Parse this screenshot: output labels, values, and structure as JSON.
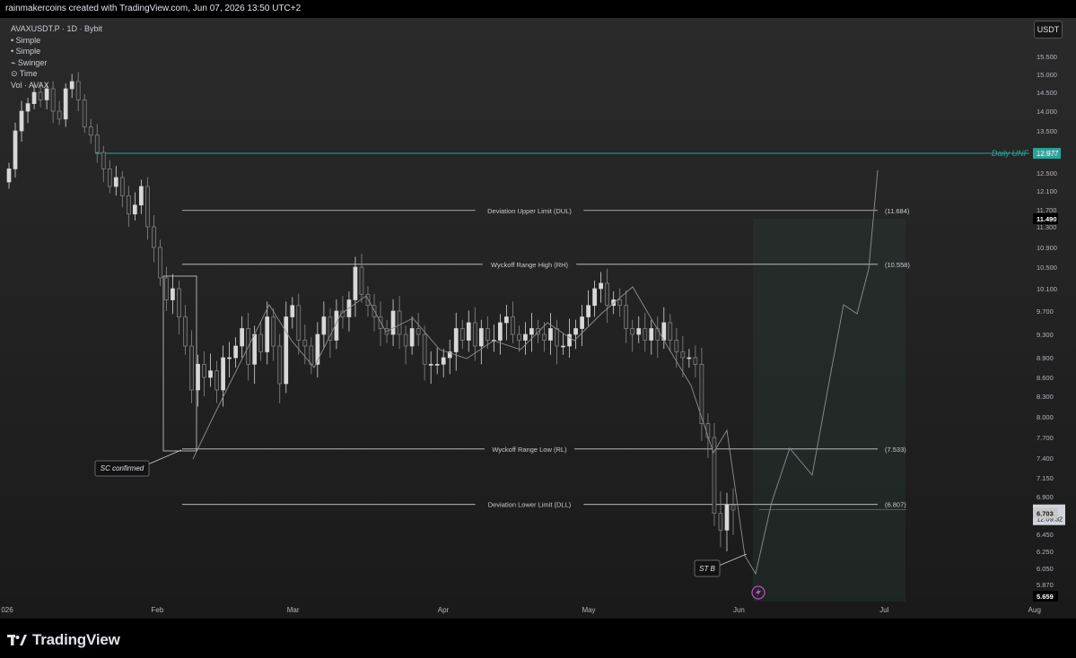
{
  "header": {
    "attribution": "rainmakercoins created with TradingView.com, Jun 07, 2026 13:50 UTC+2"
  },
  "legend": {
    "symbol": "AVAXUSDT.P · 1D · Bybit",
    "items": [
      "• Simple",
      "• Simple",
      "⌁ Swinger",
      "⊙ Time",
      "Vol · AVAX"
    ]
  },
  "currency_button": "USDT",
  "footer": {
    "brand": "TradingView"
  },
  "colors": {
    "accent": "#26a69a",
    "candle_up": "#d8d8d8",
    "candle_down": "#8a8a8a",
    "background": "#1e1e1e"
  },
  "chart_data": {
    "type": "candlestick",
    "instrument": "AVAXUSDT.P",
    "timeframe": "1D",
    "exchange": "Bybit",
    "x_axis": {
      "ticks": [
        {
          "label": "026",
          "day": 3
        },
        {
          "label": "Feb",
          "day": 34
        },
        {
          "label": "Mar",
          "day": 62
        },
        {
          "label": "Apr",
          "day": 93
        },
        {
          "label": "May",
          "day": 123
        },
        {
          "label": "Jun",
          "day": 154
        },
        {
          "label": "Jul",
          "day": 184
        },
        {
          "label": "Aug",
          "day": 215
        }
      ]
    },
    "y_axis": {
      "min": 5.659,
      "max": 15.9,
      "ticks": [
        "15.500",
        "15.000",
        "14.500",
        "14.000",
        "13.500",
        "13.000",
        "12.500",
        "12.100",
        "11.700",
        "11.300",
        "10.900",
        "10.500",
        "10.100",
        "9.700",
        "9.300",
        "8.900",
        "8.600",
        "8.300",
        "8.000",
        "7.700",
        "7.400",
        "7.150",
        "6.900",
        "6.450",
        "6.250",
        "6.050",
        "5.870"
      ]
    },
    "close_series": [
      12.6,
      13.5,
      14.0,
      14.2,
      14.5,
      14.3,
      14.6,
      14.0,
      13.8,
      14.6,
      14.8,
      14.3,
      13.6,
      13.4,
      13.0,
      12.6,
      12.2,
      12.4,
      12.0,
      11.6,
      11.8,
      12.2,
      11.3,
      10.9,
      10.3,
      9.9,
      10.1,
      9.6,
      9.1,
      8.4,
      8.8,
      8.6,
      8.7,
      8.4,
      8.9,
      8.9,
      9.1,
      9.4,
      8.8,
      9.3,
      9.0,
      9.6,
      9.1,
      8.5,
      9.6,
      9.8,
      9.2,
      9.1,
      8.8,
      9.3,
      9.6,
      9.2,
      9.7,
      9.6,
      9.9,
      10.5,
      10.0,
      9.8,
      9.6,
      9.4,
      9.3,
      9.7,
      9.3,
      9.1,
      9.4,
      9.3,
      8.8,
      8.8,
      8.8,
      8.9,
      9.0,
      9.4,
      9.2,
      9.5,
      9.1,
      9.4,
      9.2,
      9.2,
      9.5,
      9.6,
      9.3,
      9.2,
      9.3,
      9.4,
      9.3,
      9.2,
      9.4,
      9.1,
      9.1,
      9.3,
      9.4,
      9.6,
      9.8,
      10.1,
      10.2,
      9.8,
      9.9,
      9.8,
      9.4,
      9.3,
      9.4,
      9.2,
      9.4,
      9.2,
      9.5,
      9.2,
      9.0,
      8.9,
      8.9,
      8.8,
      7.9,
      7.7,
      6.7,
      6.5,
      6.8,
      6.74
    ],
    "levels": [
      {
        "label": "Daily UNF",
        "value": 12.977,
        "value_label": "12.977",
        "color": "#26a69a"
      },
      {
        "label": "Deviation Upper Limit (DUL)",
        "value": 11.684,
        "value_label": "(11.684)"
      },
      {
        "label": "Wyckoff Range High (RH)",
        "value": 10.558,
        "value_label": "(10.558)"
      },
      {
        "label": "Wyckoff Range Low (RL)",
        "value": 7.533,
        "value_label": "(7.533)"
      },
      {
        "label": "Deviation Lower Limit (DLL)",
        "value": 6.807,
        "value_label": "(6.807)"
      }
    ],
    "price_markers": [
      {
        "value": 11.49,
        "label": "11.490"
      },
      {
        "value": 6.742,
        "label": "6.742",
        "sublabel": "12:09:32"
      },
      {
        "value": 6.703,
        "label": "6.703"
      },
      {
        "value": 5.659,
        "label": "5.659"
      }
    ],
    "annotations": [
      {
        "text": "SC confirmed"
      },
      {
        "text": "ST B"
      }
    ]
  }
}
